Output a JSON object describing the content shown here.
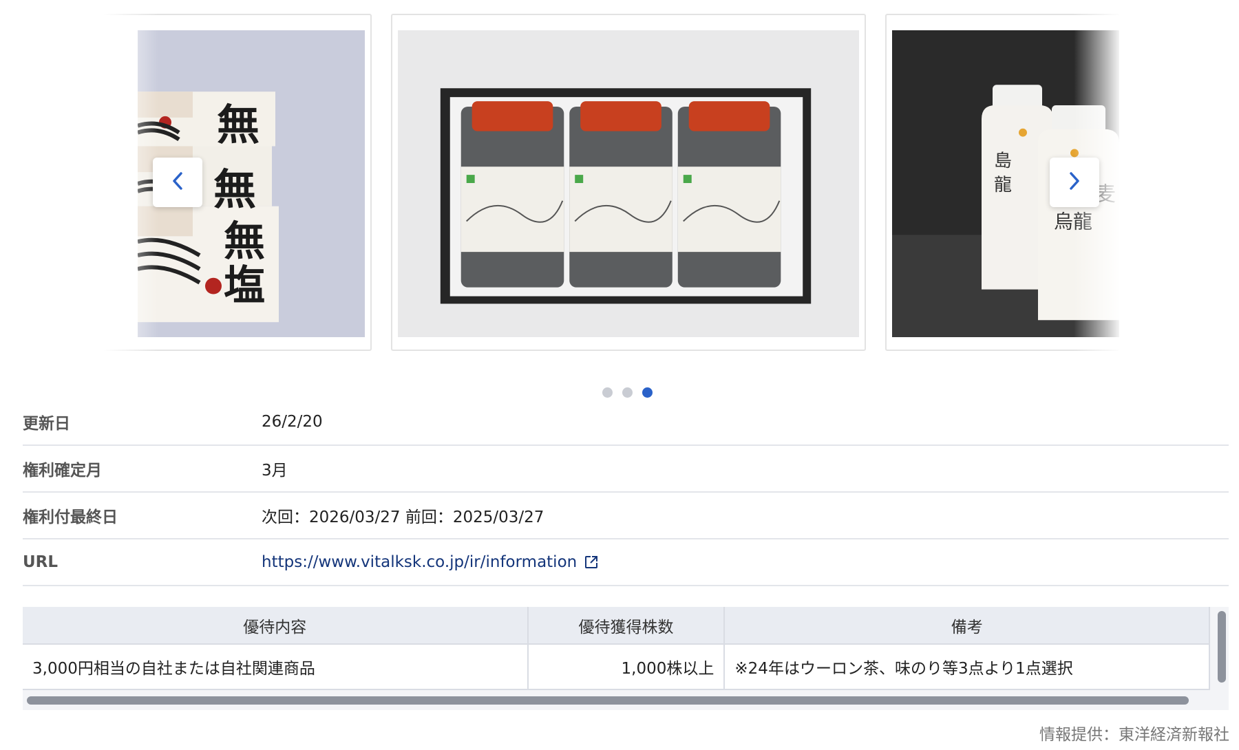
{
  "carousel": {
    "slides": [
      {
        "name": "noodles-package-photo",
        "text": "無塩"
      },
      {
        "name": "nori-jars-gift-box-photo"
      },
      {
        "name": "tea-bottles-photo"
      }
    ],
    "prev_icon": "chevron-left-icon",
    "next_icon": "chevron-right-icon",
    "dots": 3,
    "active_dot": 3
  },
  "info": {
    "rows": [
      {
        "label": "更新日",
        "value": "26/2/20"
      },
      {
        "label": "権利確定月",
        "value": "3月"
      },
      {
        "label": "権利付最終日",
        "value": "次回：2026/03/27 前回：2025/03/27"
      },
      {
        "label": "URL",
        "value": "https://www.vitalksk.co.jp/ir/information",
        "icon": "external-link-icon"
      }
    ]
  },
  "table": {
    "headers": [
      "優待内容",
      "優待獲得株数",
      "備考"
    ],
    "rows": [
      [
        "3,000円相当の自社または自社関連商品",
        "1,000株以上",
        "※24年はウーロン茶、味のり等3点より1点選択"
      ]
    ]
  },
  "credit": "情報提供：東洋経済新報社",
  "colors": {
    "accent": "#2a62c9",
    "link": "#14357a",
    "header_bg": "#e9ecf2"
  }
}
